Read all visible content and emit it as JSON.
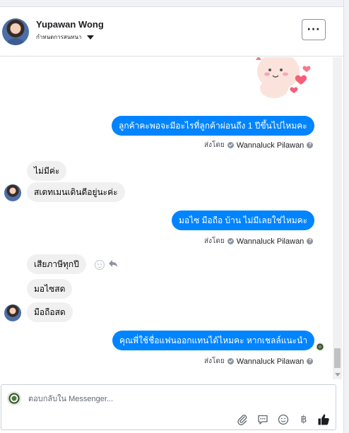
{
  "header": {
    "contact_name": "Yupawan Wong",
    "status_label": "กำหนดการสนทนา",
    "more_label": "···"
  },
  "messages": [
    {
      "direction": "out",
      "text": "ลูกค้าคะพอจะมีอะไรที่ลูกค้าผ่อนถึง 1 ปีขึ้นไปไหมคะ"
    },
    {
      "direction": "in",
      "text": "ไม่มีค่ะ"
    },
    {
      "direction": "in",
      "text": "สเตทเมนเดินดีอยู่นะค่ะ"
    },
    {
      "direction": "out",
      "text": "มอไซ มือถือ บ้าน ไม่มีเลยใช่ไหมคะ"
    },
    {
      "direction": "in",
      "text": "เสียภาษีทุกปี"
    },
    {
      "direction": "in",
      "text": "มอไซสด"
    },
    {
      "direction": "in",
      "text": "มือถือสด"
    },
    {
      "direction": "out",
      "text": "คุณพี่ใช้ชื่อแฟนออกแทนได้ไหมคะ หากเชลล์แนะนำ"
    }
  ],
  "sent_by": {
    "prefix": "ส่งโดย",
    "agent": "Wannaluck Pilawan",
    "help": "?"
  },
  "composer": {
    "placeholder": "ตอบกลับใน Messenger..."
  },
  "toolbar": {
    "attach_icon": "paperclip-icon",
    "saved_reply_icon": "speech-bubble-icon",
    "emoji_icon": "smile-icon",
    "payment_label": "฿",
    "like_icon": "thumbs-up-icon"
  },
  "colors": {
    "outgoing_bubble": "#0084ff",
    "incoming_bubble": "#f1f0f0",
    "like_icon": "#1c1e21"
  }
}
